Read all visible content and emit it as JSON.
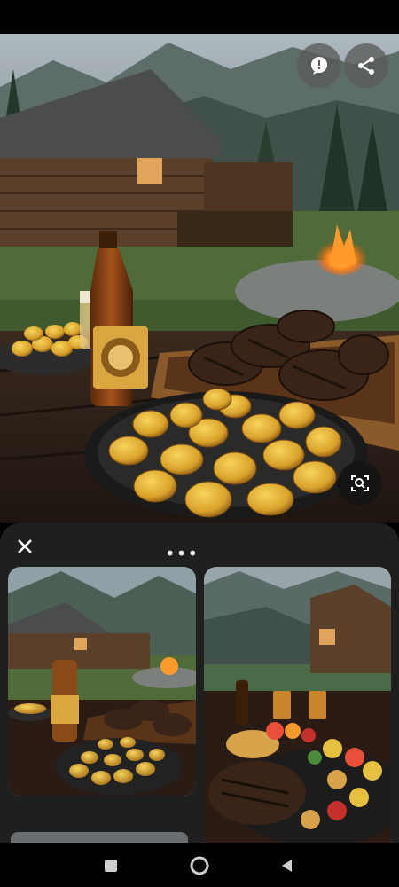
{
  "status_bar": {},
  "hero": {
    "image_description": "log-cabin-steak-dinner",
    "actions": [
      {
        "name": "feedback",
        "icon": "feedback-icon"
      },
      {
        "name": "share",
        "icon": "share-icon"
      }
    ],
    "lens_icon": "lens-search-icon"
  },
  "results_sheet": {
    "close_icon": "close-icon",
    "more_label": "•••",
    "results": [
      {
        "name": "result-cabin-steak-potatoes"
      },
      {
        "name": "result-cabin-grill-vegetables"
      }
    ]
  },
  "nav_bar": {
    "recents_icon": "square-icon",
    "home_icon": "circle-icon",
    "back_icon": "triangle-back-icon"
  },
  "colors": {
    "sheet_bg": "#1f1f1f",
    "button_bg": "#5a5a5a",
    "icon_fg": "#ffffff"
  }
}
